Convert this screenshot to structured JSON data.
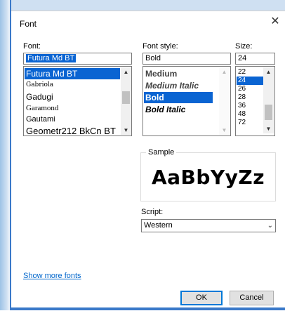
{
  "dialog": {
    "title": "Font"
  },
  "font": {
    "label": "Font:",
    "value": "Futura Md BT",
    "items": [
      "Futura Md BT",
      "Gabriola",
      "Gadugi",
      "Garamond",
      "Gautami",
      "Geometr212 BkCn BT"
    ]
  },
  "style": {
    "label": "Font style:",
    "value": "Bold",
    "items": [
      "Medium",
      "Medium Italic",
      "Bold",
      "Bold Italic"
    ]
  },
  "size": {
    "label": "Size:",
    "value": "24",
    "items": [
      "22",
      "24",
      "26",
      "28",
      "36",
      "48",
      "72"
    ]
  },
  "sample": {
    "label": "Sample",
    "text": "AaBbYyZz"
  },
  "script": {
    "label": "Script:",
    "value": "Western"
  },
  "links": {
    "show_more_fonts": "Show more fonts"
  },
  "buttons": {
    "ok": "OK",
    "cancel": "Cancel"
  },
  "icons": {
    "close": "close-icon",
    "chevron_up": "chevron-up-icon",
    "chevron_down": "chevron-down-icon"
  }
}
